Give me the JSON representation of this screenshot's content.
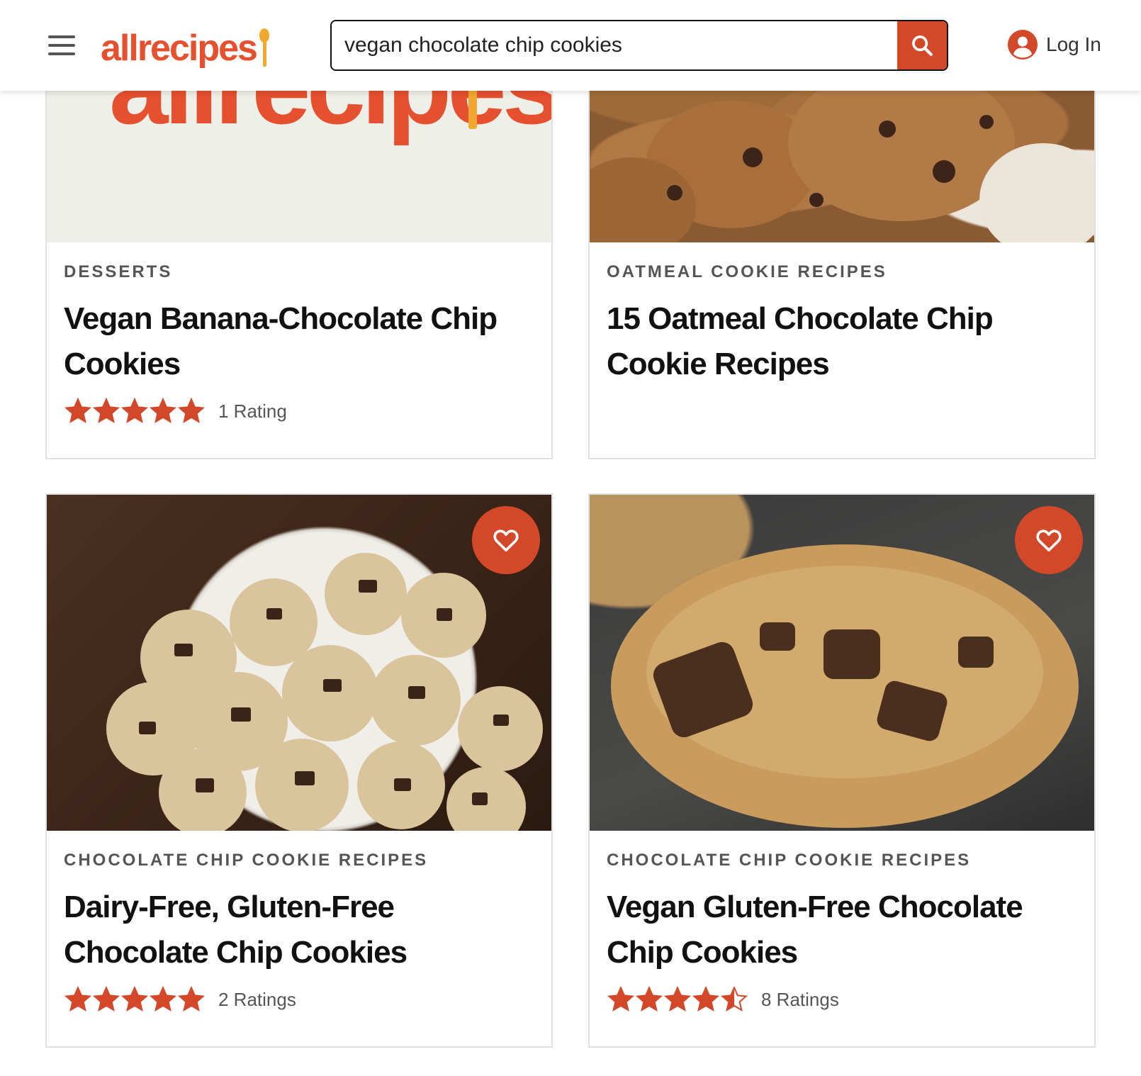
{
  "brand": {
    "name": "allrecipes",
    "accent": "#e5502e",
    "button_color": "#d4482a",
    "star_color": "#d4482a"
  },
  "header": {
    "search_value": "vegan chocolate chip cookies",
    "login_label": "Log In"
  },
  "cards": [
    {
      "category": "DESSERTS",
      "title": "Vegan Banana-Chocolate Chip Cookies",
      "rating_stars": 5,
      "rating_label": "1 Rating",
      "image_icon": "allrecipes-logo-placeholder"
    },
    {
      "category": "OATMEAL COOKIE RECIPES",
      "title": "15 Oatmeal Chocolate Chip Cookie Recipes",
      "image_icon": "oatmeal-cookies-photo"
    },
    {
      "category": "CHOCOLATE CHIP COOKIE RECIPES",
      "title": "Dairy-Free, Gluten-Free Chocolate Chip Cookies",
      "rating_stars": 5,
      "rating_label": "2 Ratings",
      "image_icon": "cookies-in-bowl-photo"
    },
    {
      "category": "CHOCOLATE CHIP COOKIE RECIPES",
      "title": "Vegan Gluten-Free Chocolate Chip Cookies",
      "rating_stars": 4.5,
      "rating_label": "8 Ratings",
      "image_icon": "single-cookie-photo"
    }
  ]
}
